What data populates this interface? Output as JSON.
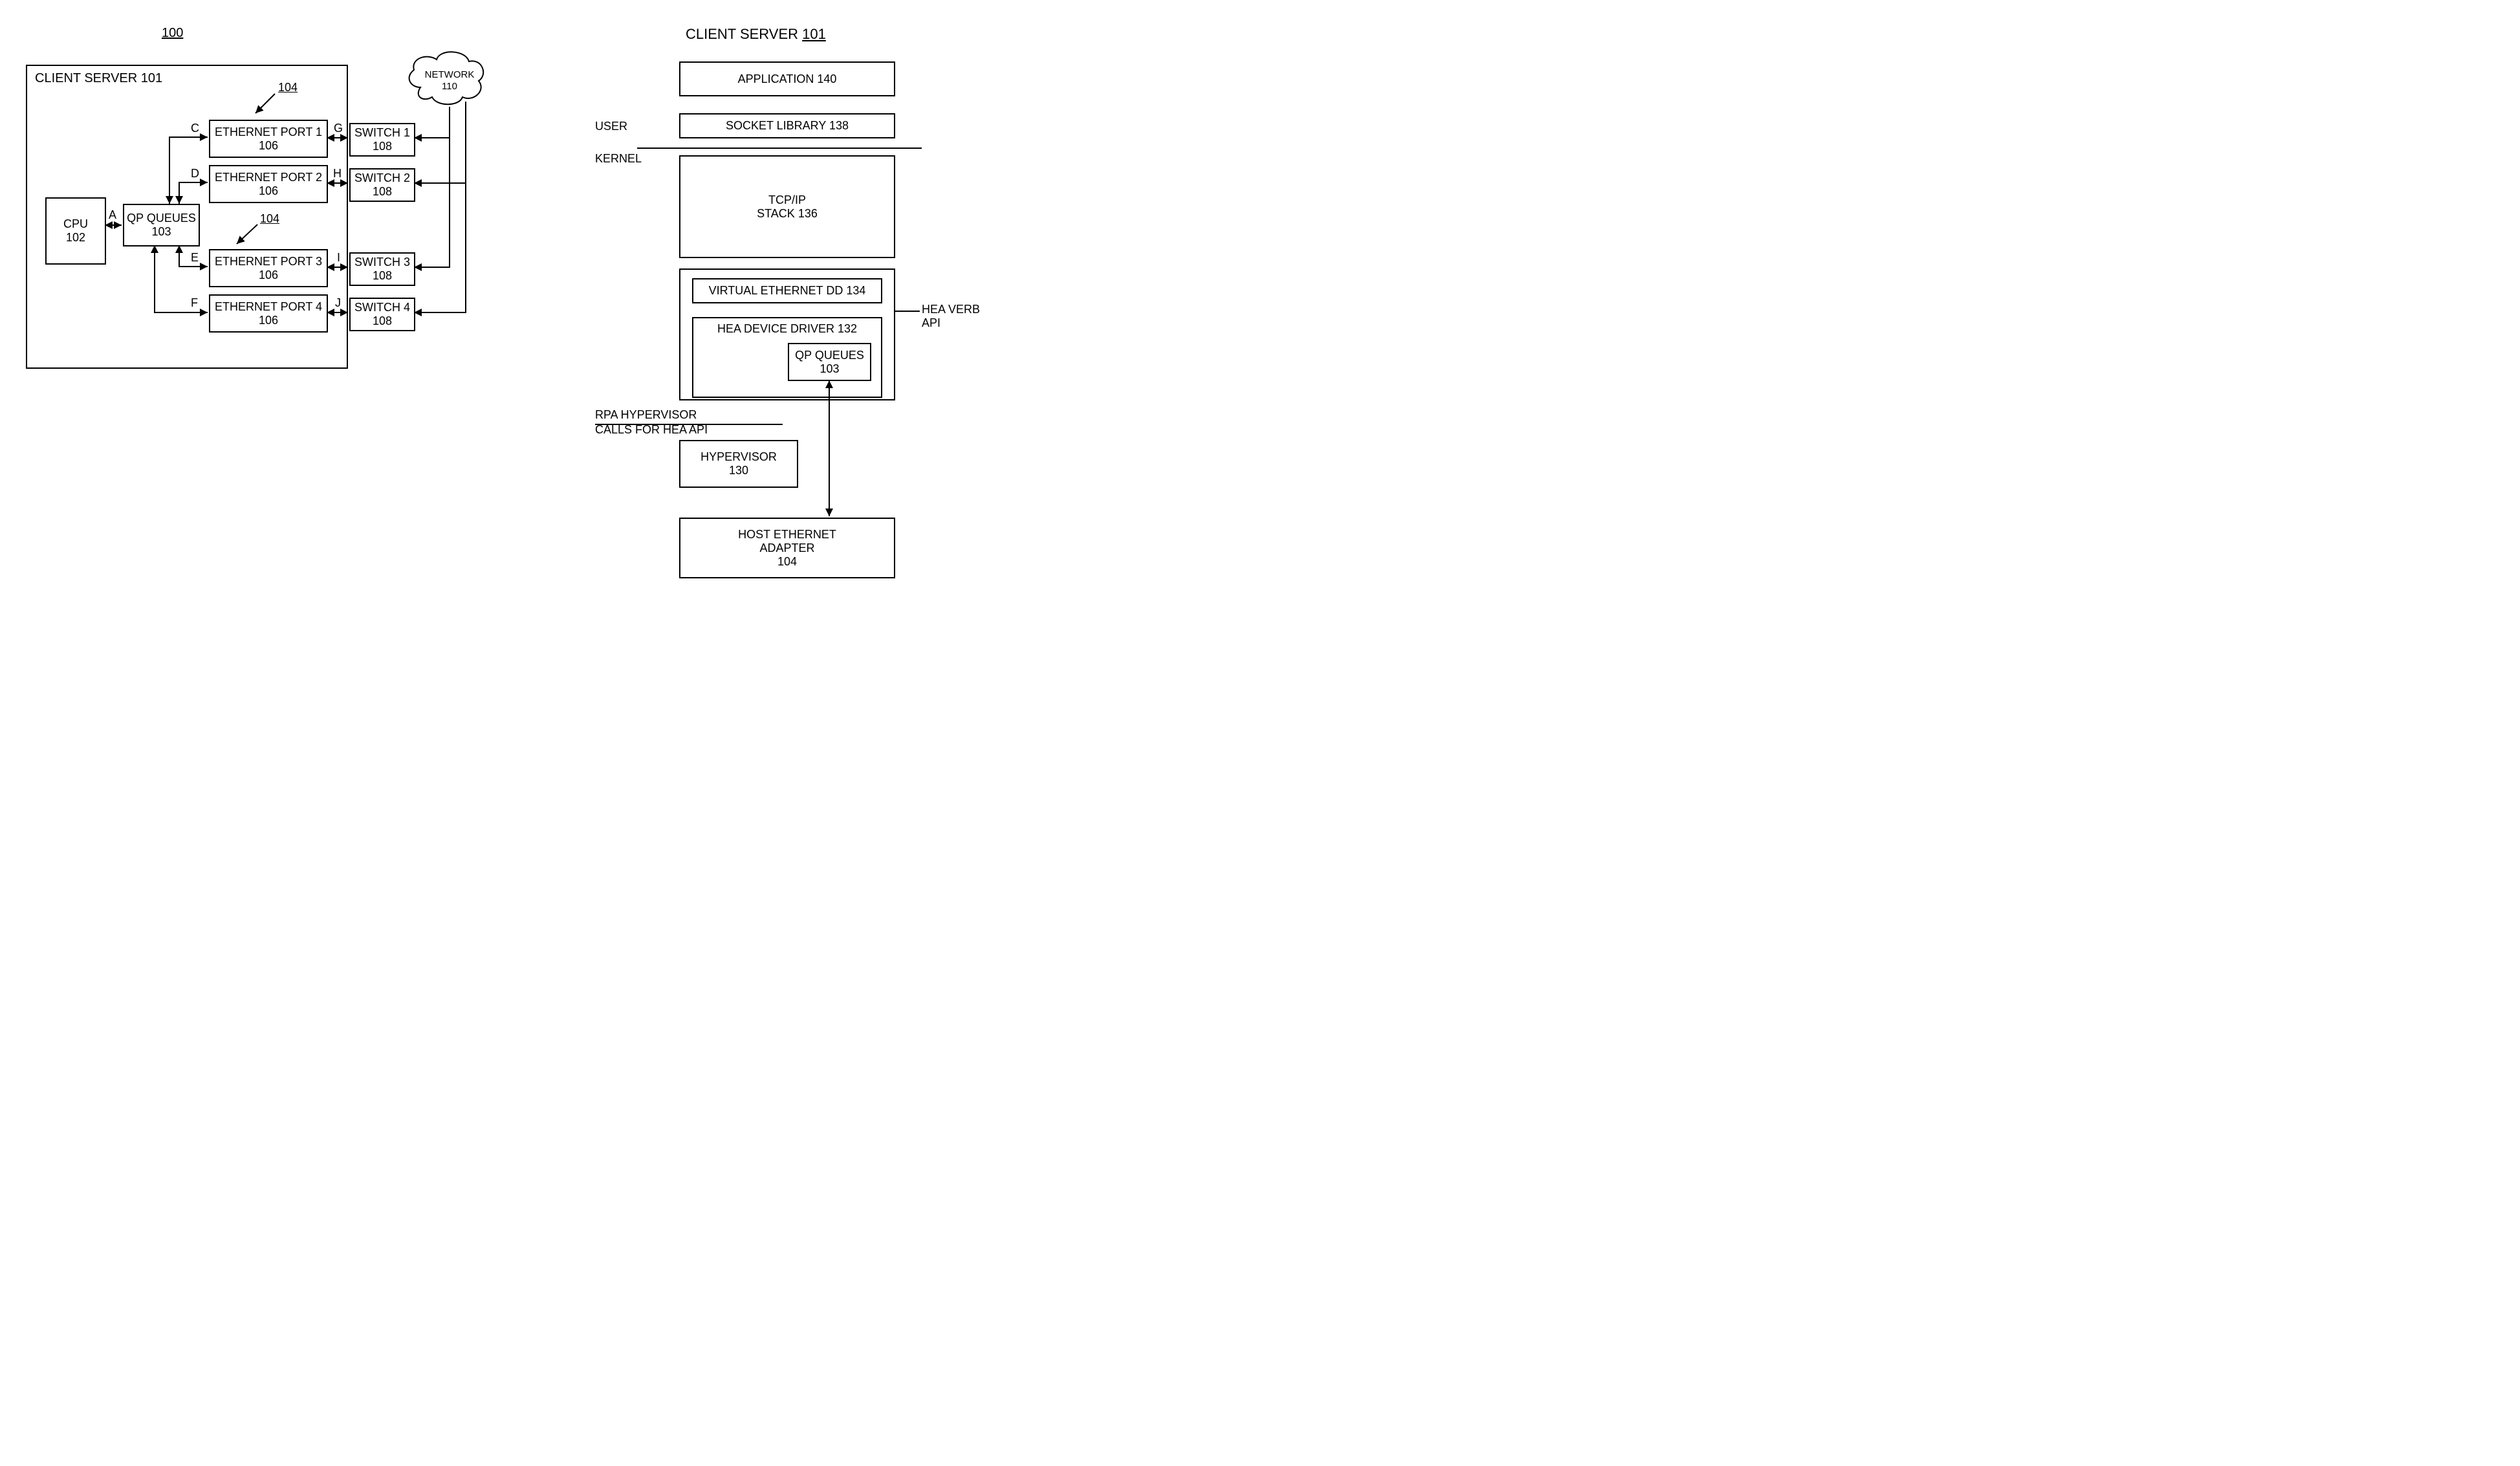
{
  "left": {
    "system_ref": "100",
    "client_server": "CLIENT SERVER 101",
    "cpu_line1": "CPU",
    "cpu_line2": "102",
    "qp_line1": "QP QUEUES",
    "qp_line2": "103",
    "hea_ref": "104",
    "port1_line1": "ETHERNET PORT 1",
    "port1_line2": "106",
    "port2_line1": "ETHERNET PORT 2",
    "port2_line2": "106",
    "port3_line1": "ETHERNET PORT 3",
    "port3_line2": "106",
    "port4_line1": "ETHERNET PORT 4",
    "port4_line2": "106",
    "sw1_line1": "SWITCH 1",
    "sw1_line2": "108",
    "sw2_line1": "SWITCH 2",
    "sw2_line2": "108",
    "sw3_line1": "SWITCH 3",
    "sw3_line2": "108",
    "sw4_line1": "SWITCH 4",
    "sw4_line2": "108",
    "network_line1": "NETWORK",
    "network_line2": "110",
    "lA": "A",
    "lC": "C",
    "lD": "D",
    "lE": "E",
    "lF": "F",
    "lG": "G",
    "lH": "H",
    "lI": "I",
    "lJ": "J"
  },
  "right": {
    "title_prefix": "CLIENT SERVER ",
    "title_ref": "101",
    "app": "APPLICATION 140",
    "socket": "SOCKET LIBRARY 138",
    "user": "USER",
    "kernel": "KERNEL",
    "tcp_line1": "TCP/IP",
    "tcp_line2": "STACK 136",
    "veth": "VIRTUAL ETHERNET DD 134",
    "hea_dd": "HEA DEVICE DRIVER 132",
    "qp_line1": "QP QUEUES",
    "qp_line2": "103",
    "hea_verb": "HEA VERB API",
    "rpa_line1": "RPA HYPERVISOR",
    "rpa_line2": "CALLS FOR HEA API",
    "hyp_line1": "HYPERVISOR",
    "hyp_line2": "130",
    "adapter_line1": "HOST ETHERNET",
    "adapter_line2": "ADAPTER",
    "adapter_line3": "104"
  }
}
